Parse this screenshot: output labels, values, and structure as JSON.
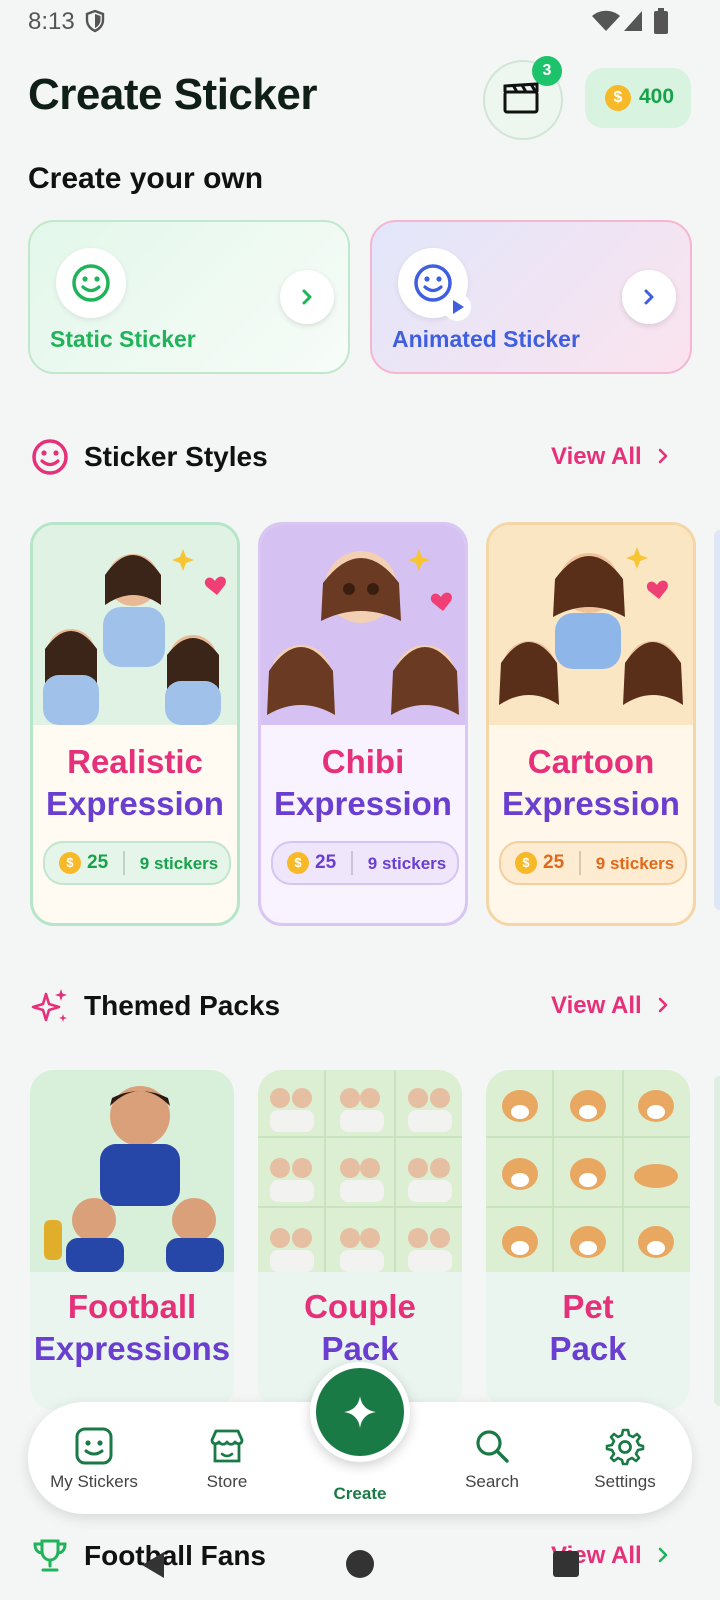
{
  "status": {
    "time": "8:13"
  },
  "header": {
    "title": "Create Sticker",
    "notification_count": "3",
    "coin_balance": "400"
  },
  "create_section": {
    "title": "Create your own",
    "static_label": "Static Sticker",
    "animated_label": "Animated Sticker"
  },
  "sticker_styles": {
    "title": "Sticker Styles",
    "view_all": "View All",
    "cards": [
      {
        "line1": "Realistic",
        "line2": "Expression",
        "price": "25",
        "count": "9 stickers",
        "accent": "#16a34a"
      },
      {
        "line1": "Chibi",
        "line2": "Expression",
        "price": "25",
        "count": "9 stickers",
        "accent": "#6a3fd0"
      },
      {
        "line1": "Cartoon",
        "line2": "Expression",
        "price": "25",
        "count": "9 stickers",
        "accent": "#e0691a"
      }
    ]
  },
  "themed_packs": {
    "title": "Themed Packs",
    "view_all": "View All",
    "cards": [
      {
        "line1": "Football",
        "line2": "Expressions"
      },
      {
        "line1": "Couple",
        "line2": "Pack"
      },
      {
        "line1": "Pet",
        "line2": "Pack"
      }
    ]
  },
  "football_fans": {
    "title": "Football Fans",
    "view_all": "View All"
  },
  "bottom_nav": {
    "my_stickers": "My Stickers",
    "store": "Store",
    "create": "Create",
    "search": "Search",
    "settings": "Settings"
  },
  "colors": {
    "primary": "#1a7a46",
    "accent_pink": "#e6307a",
    "accent_purple": "#6a3fd0",
    "coin": "#f7b928"
  }
}
